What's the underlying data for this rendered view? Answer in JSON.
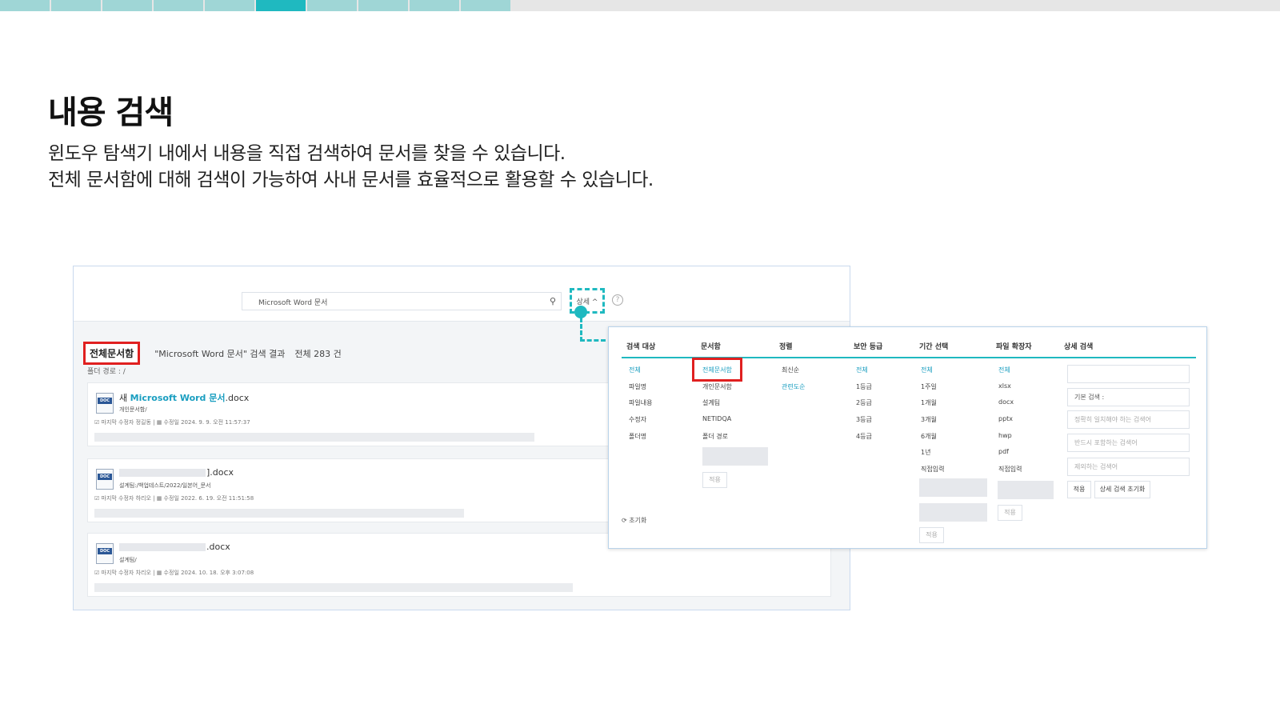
{
  "progress": {
    "total_segments": 10,
    "active_index": 5
  },
  "page": {
    "title": "내용 검색",
    "desc_line1": "윈도우 탐색기 내에서 내용을 직접 검색하여 문서를 찾을 수 있습니다.",
    "desc_line2": "전체 문서함에 대해 검색이 가능하여 사내 문서를 효율적으로 활용할 수 있습니다."
  },
  "search": {
    "value": "Microsoft Word 문서",
    "detail_label": "상세 ^",
    "help": "?"
  },
  "results": {
    "folder": "전체문서함",
    "query_text": "\"Microsoft Word 문서\" 검색 결과",
    "count_text": "전체 283 건",
    "path_label": "폴더 경로 : /",
    "items": [
      {
        "prefix": "새 ",
        "highlight": "Microsoft Word 문서",
        "suffix": ".docx",
        "path": "개인문서함/",
        "meta": "☑ 마지막 수정자 정길동 | ▦ 수정일 2024. 9. 9. 오전 11:57:37"
      },
      {
        "prefix": "",
        "highlight": "",
        "suffix": "].docx",
        "path": "설계팀:/백업테스트/2022/일본어_문서",
        "meta": "☑ 마지막 수정자 하리오 | ▦ 수정일 2022. 6. 19. 오전 11:51:58"
      },
      {
        "prefix": "",
        "highlight": "",
        "suffix": ".docx",
        "path": "설계팀/",
        "meta": "☑ 마지막 수정자 차리오 | ▦ 수정일 2024. 10. 18. 오후 3:07:08"
      }
    ]
  },
  "panel": {
    "headers": [
      "검색 대상",
      "문서함",
      "정렬",
      "보안 등급",
      "기간 선택",
      "파일 확장자",
      "상세 검색"
    ],
    "target": [
      "전체",
      "파일명",
      "파일내용",
      "수정자",
      "폴더명"
    ],
    "box": [
      "전체문서함",
      "개인문서함",
      "설계팀",
      "NETIDQA",
      "폴더 경로"
    ],
    "sort": [
      "최신순",
      "관련도순"
    ],
    "security": [
      "전체",
      "1등급",
      "2등급",
      "3등급",
      "4등급"
    ],
    "period": [
      "전체",
      "1주일",
      "1개월",
      "3개월",
      "6개월",
      "1년",
      "직접입력"
    ],
    "ext": [
      "전체",
      "xlsx",
      "docx",
      "pptx",
      "hwp",
      "pdf",
      "직접입력"
    ],
    "detail": {
      "basic_label": "기본 검색 :",
      "exact_placeholder": "정확히 일치해야 하는 검색어",
      "must_placeholder": "반드시 포함하는 검색어",
      "exclude_placeholder": "제외하는 검색어",
      "apply": "적용",
      "reset_detail": "상세 검색 초기화"
    },
    "apply_label": "적용",
    "reset_label": "⟳ 초기화"
  }
}
